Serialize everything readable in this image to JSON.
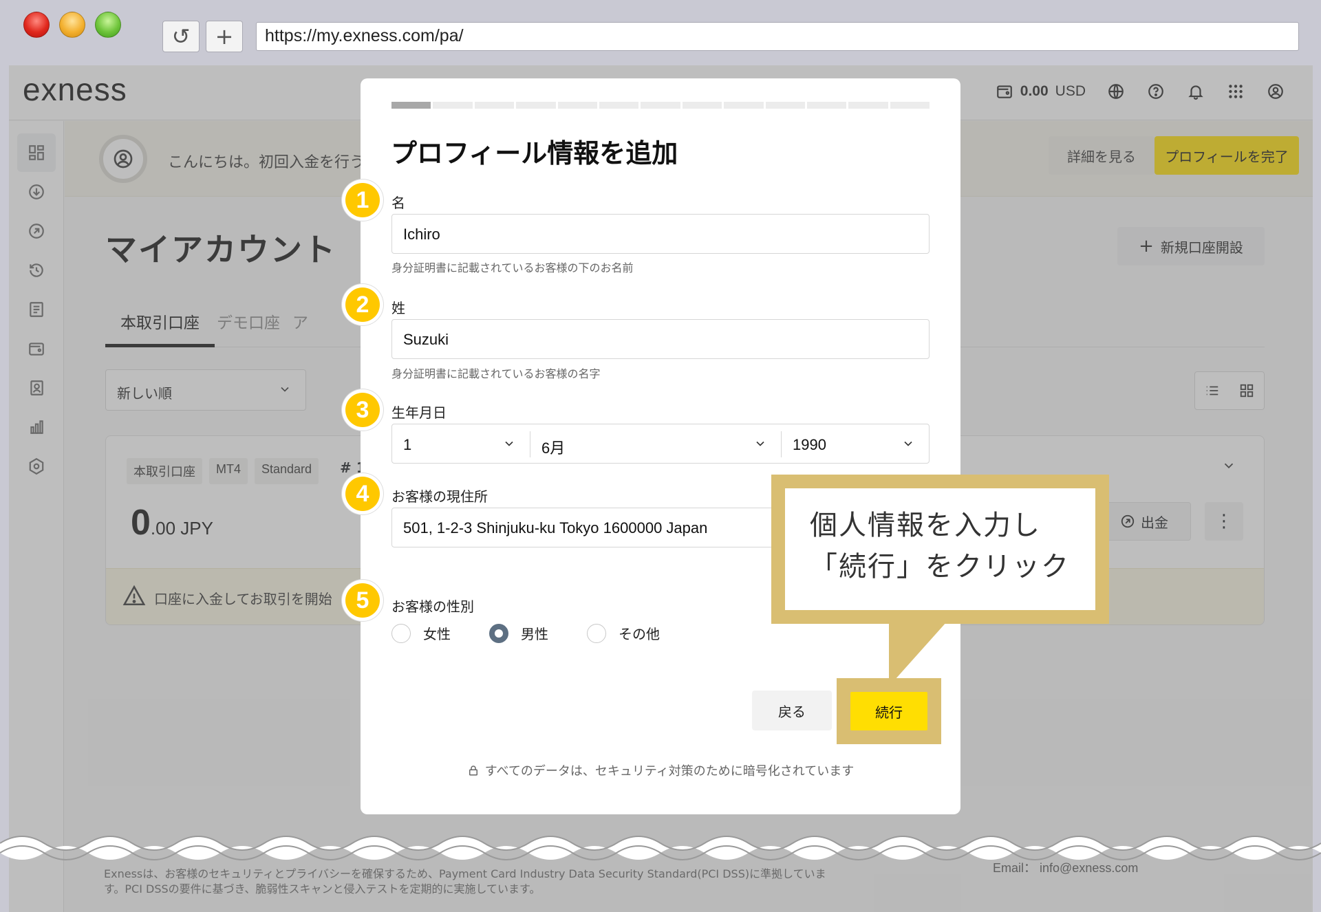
{
  "browser": {
    "url": "https://my.exness.com/pa/",
    "reload_symbol": "↺",
    "newtab_symbol": "+"
  },
  "header": {
    "logo": "exness",
    "balance": "0.00",
    "currency": "USD"
  },
  "banner": {
    "text": "こんにちは。初回入金を行うた",
    "detail_button": "詳細を見る",
    "complete_button": "プロフィールを完了"
  },
  "main": {
    "title": "マイアカウント",
    "new_account_button": "新規口座開設",
    "tabs": [
      {
        "label": "本取引口座"
      },
      {
        "label": "デモ口座"
      },
      {
        "label": "ア"
      }
    ],
    "sort_label": "新しい順"
  },
  "account": {
    "tags": [
      "本取引口座",
      "MT4",
      "Standard"
    ],
    "number_prefix": "# 1",
    "balance_int": "0",
    "balance_dec": ".00 JPY",
    "withdraw_button": "出金",
    "footer_text": "口座に入金してお取引を開始"
  },
  "footer": {
    "text": "Exnessは、お客様のセキュリティとプライバシーを確保するため、Payment Card Industry Data Security Standard(PCI DSS)に準拠しています。PCI DSSの要件に基づき、脆弱性スキャンと侵入テストを定期的に実施しています。",
    "email": "Email： info@exness.com"
  },
  "modal": {
    "progress_total": 13,
    "progress_done": 1,
    "title": "プロフィール情報を追加",
    "first_name": {
      "label": "名",
      "value": "Ichiro",
      "hint": "身分証明書に記載されているお客様の下のお名前"
    },
    "last_name": {
      "label": "姓",
      "value": "Suzuki",
      "hint": "身分証明書に記載されているお客様の名字"
    },
    "birthdate": {
      "label": "生年月日",
      "day": "1",
      "month": "6月",
      "year": "1990"
    },
    "address": {
      "label": "お客様の現住所",
      "value": "501, 1-2-3 Shinjuku-ku Tokyo 1600000 Japan"
    },
    "gender": {
      "label": "お客様の性別",
      "options": [
        "女性",
        "男性",
        "その他"
      ],
      "selected": "男性"
    },
    "back_button": "戻る",
    "continue_button": "続行",
    "security_note": "すべてのデータは、セキュリティ対策のために暗号化されています"
  },
  "annotations": {
    "steps": [
      "1",
      "2",
      "3",
      "4",
      "5"
    ],
    "callout_line1": "個人情報を入力し",
    "callout_line2": "「続行」をクリック",
    "colors": {
      "badge": "#ffc800",
      "callout": "#d9be72",
      "accent": "#ffde02"
    }
  }
}
